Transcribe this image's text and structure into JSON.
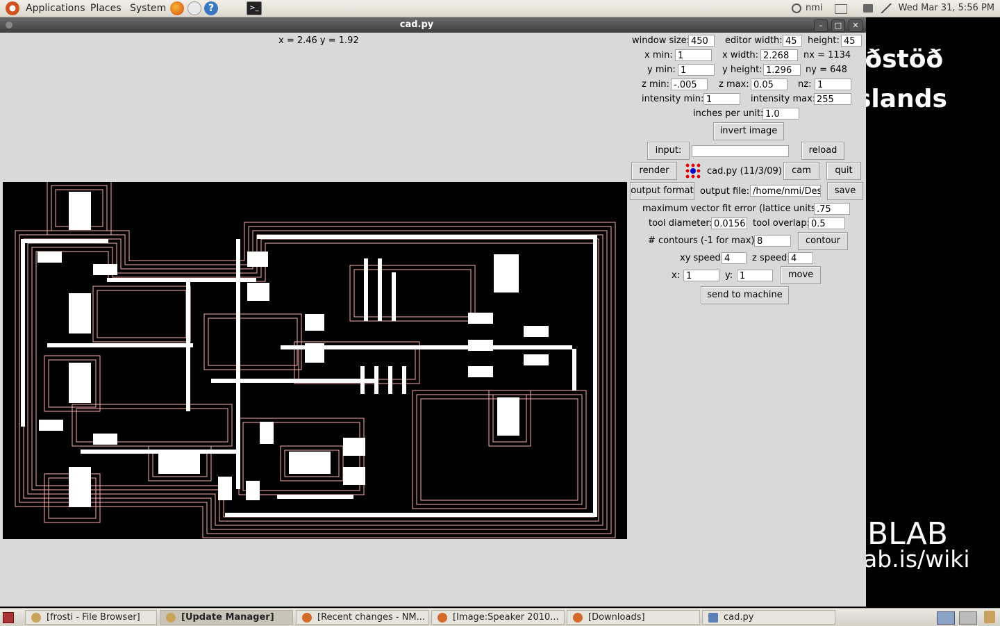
{
  "top_panel": {
    "menus": [
      "Applications",
      "Places",
      "System"
    ],
    "user": "nmi",
    "clock": "Wed Mar 31,  5:56 PM"
  },
  "desktop": {
    "line1": "iðstöð",
    "line2": "slands",
    "line3": "BLAB",
    "line4": "ab.is/wiki"
  },
  "window": {
    "title": "cad.py",
    "coords": "x = 2.46  y = 1.92"
  },
  "form": {
    "window_size_label": "window size:",
    "window_size": "450",
    "editor_width_label": "editor width:",
    "editor_width": "45",
    "height_label": "height:",
    "height": "45",
    "xmin_label": "x min:",
    "xmin": "1",
    "xwidth_label": "x width:",
    "xwidth": "2.268",
    "nx": "nx = 1134",
    "ymin_label": "y min:",
    "ymin": "1",
    "yheight_label": "y height:",
    "yheight": "1.296",
    "ny": "ny = 648",
    "zmin_label": "z min:",
    "zmin": "-.005",
    "zmax_label": "z max:",
    "zmax": "0.05",
    "nz_label": "nz:",
    "nz": "1",
    "imin_label": "intensity min:",
    "imin": "1",
    "imax_label": "intensity max:",
    "imax": "255",
    "ipu_label": "inches per unit:",
    "ipu": "1.0",
    "invert_image": "invert image",
    "input_button": "input:",
    "input_value": "",
    "reload": "reload",
    "render": "render",
    "app_label": "cad.py (11/3/09)",
    "cam": "cam",
    "quit": "quit",
    "output_format": "output format",
    "output_file_label": "output file:",
    "output_file": "/home/nmi/Desk",
    "save": "save",
    "mvfe_label": "maximum vector fit error (lattice units):",
    "mvfe": ".75",
    "tool_diameter_label": "tool diameter:",
    "tool_diameter": "0.0156",
    "tool_overlap_label": "tool overlap:",
    "tool_overlap": "0.5",
    "contours_label": "# contours (-1 for max):",
    "contours": "8",
    "contour": "contour",
    "xy_speed_label": "xy speed:",
    "xy_speed": "4",
    "z_speed_label": "z speed:",
    "z_speed": "4",
    "x_label": "x:",
    "x": "1",
    "y_label": "y:",
    "y": "1",
    "move": "move",
    "send": "send to machine"
  },
  "taskbar": [
    {
      "label": "[frosti - File Browser]",
      "active": false
    },
    {
      "label": "[Update Manager]",
      "active": true
    },
    {
      "label": "[Recent changes - NM...",
      "active": false
    },
    {
      "label": "[Image:Speaker 2010...",
      "active": false
    },
    {
      "label": "[Downloads]",
      "active": false
    },
    {
      "label": "cad.py",
      "active": false
    }
  ]
}
